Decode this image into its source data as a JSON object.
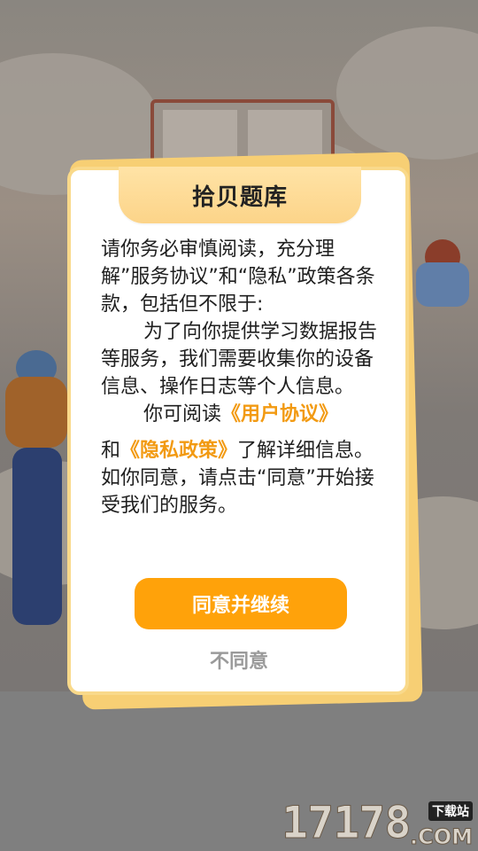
{
  "dialog": {
    "title": "拾贝题库",
    "intro": "请你务必审慎阅读，充分理解”服务协议”和“隐私”政策各条款，包括但不限于:",
    "purpose": "为了向你提供学习数据报告等服务，我们需要收集你的设备信息、操作日志等个人信息。",
    "read_prefix": "你可阅读",
    "user_agreement_link": "《用户协议》",
    "and_text": "和",
    "privacy_policy_link": "《隐私政策》",
    "details_text": "了解详细信息。如你同意，请点击“同意”开始接受我们的服务。",
    "agree_button": "同意并继续",
    "disagree_button": "不同意"
  },
  "watermark": {
    "digits": "17178",
    "badge": "下载站",
    "suffix": ".COM"
  },
  "colors": {
    "accent": "#ffa20a",
    "link": "#f29a12",
    "title_tab": "#fcd489",
    "dialog_border": "#f9d98a"
  }
}
